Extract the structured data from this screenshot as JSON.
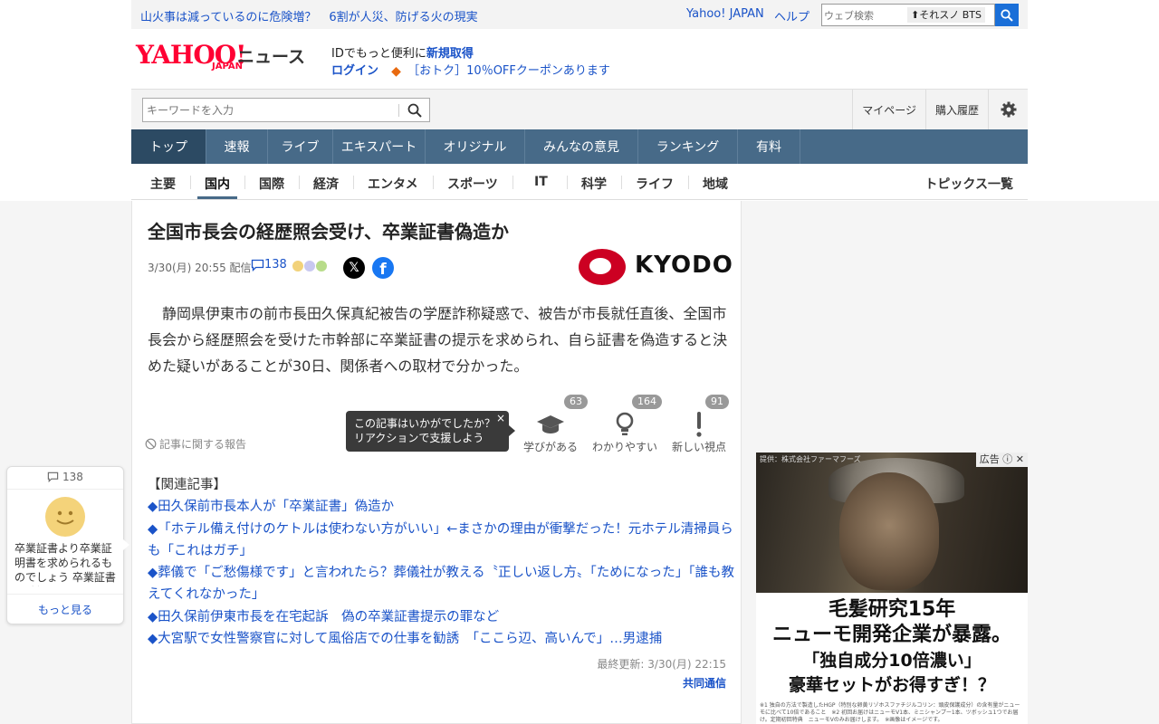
{
  "topbar": {
    "headline_part1": "山火事は減っているのに危険増？",
    "headline_part2": "6割が人災、防げる火の現実",
    "yahoo_japan": "Yahoo! JAPAN",
    "help": "ヘルプ",
    "web_search_placeholder": "ウェブ検索",
    "trend_word": "それスノ BTS"
  },
  "logo": {
    "brand": "YAHOO!",
    "sub": "JAPAN",
    "section": "ニュース"
  },
  "promo": {
    "line1_prefix": "IDでもっと便利に",
    "line1_link": "新規取得",
    "login": "ログイン",
    "coupon": "［おトク］10％OFFクーポンあります"
  },
  "search": {
    "placeholder": "キーワードを入力",
    "mypage": "マイページ",
    "history": "購入履歴"
  },
  "main_nav": [
    {
      "label": "トップ",
      "active": true
    },
    {
      "label": "速報"
    },
    {
      "label": "ライブ"
    },
    {
      "label": "エキスパート"
    },
    {
      "label": "オリジナル"
    },
    {
      "label": "みんなの意見"
    },
    {
      "label": "ランキング"
    },
    {
      "label": "有料"
    }
  ],
  "sub_nav": {
    "items": [
      "主要",
      "国内",
      "国際",
      "経済",
      "エンタメ",
      "スポーツ",
      "IT",
      "科学",
      "ライフ",
      "地域"
    ],
    "active": "国内",
    "topics": "トピックス一覧"
  },
  "article": {
    "title": "全国市長会の経歴照会受け、卒業証書偽造か",
    "date": "3/30(月) 20:55",
    "delivered": "配信",
    "comment_count": "138",
    "publisher_logo": "KYODO",
    "body": "静岡県伊東市の前市長田久保真紀被告の学歴詐称疑惑で、被告が市長就任直後、全国市長会から経歴照会を受けた市幹部に卒業証書の提示を求められ、自ら証書を偽造すると決めた疑いがあることが30日、関係者への取材で分かった。",
    "report": "記事に関する報告",
    "tooltip_line1": "この記事はいかがでしたか？",
    "tooltip_line2": "リアクションで支援しよう",
    "tooltip_close": "×",
    "reactions": [
      {
        "label": "学びがある",
        "count": "63",
        "icon": "graduation-cap-icon"
      },
      {
        "label": "わかりやすい",
        "count": "164",
        "icon": "lightbulb-icon"
      },
      {
        "label": "新しい視点",
        "count": "91",
        "icon": "exclamation-icon"
      }
    ],
    "related_heading": "【関連記事】",
    "related": [
      "◆田久保前市長本人が「卒業証書」偽造か",
      "◆「ホテル備え付けのケトルは使わない方がいい」←まさかの理由が衝撃だった！元ホテル清掃員らも「これはガチ」",
      "◆葬儀で「ご愁傷様です」と言われたら？葬儀社が教える〝正しい返し方〟「ためになった」「誰も教えてくれなかった」",
      "◆田久保前伊東市長を在宅起訴　偽の卒業証書提示の罪など",
      "◆大宮駅で女性警察官に対して風俗店での仕事を勧誘　「ここら辺、高いんで」…男逮捕"
    ],
    "updated": "最終更新: 3/30(月) 22:15",
    "source": "共同通信"
  },
  "comment_widget": {
    "count": "138",
    "text": "卒業証書より卒業証明書を求められるものでしょう 卒業証書で確認するのは",
    "more": "もっと見る"
  },
  "ad": {
    "label": "広告",
    "caption": "提供：株式会社ファーマフーズ",
    "headline1": "毛髪研究15年",
    "headline2": "ニューモ開発企業が暴露。",
    "headline3": "「独自成分10倍濃い」",
    "headline4": "豪華セットがお得すぎ！？",
    "fine_print": "※1 独自の方法で製造したHGP（特別な卵黄リゾホスファチジルコリン：頭皮保護成分）の含有量がニューモに比べて10倍であること　※2 初回お届けはニューモV1本、ミニシャンプー1本、ツボッシュ1つでお届け。定期初回特典　ニューモVのみお届けします。　※画像はイメージです。"
  },
  "colors": {
    "brand_red": "#ff0033",
    "link_blue": "#1a53c8",
    "nav_blue": "#476a88",
    "nav_active": "#2c4a63"
  }
}
